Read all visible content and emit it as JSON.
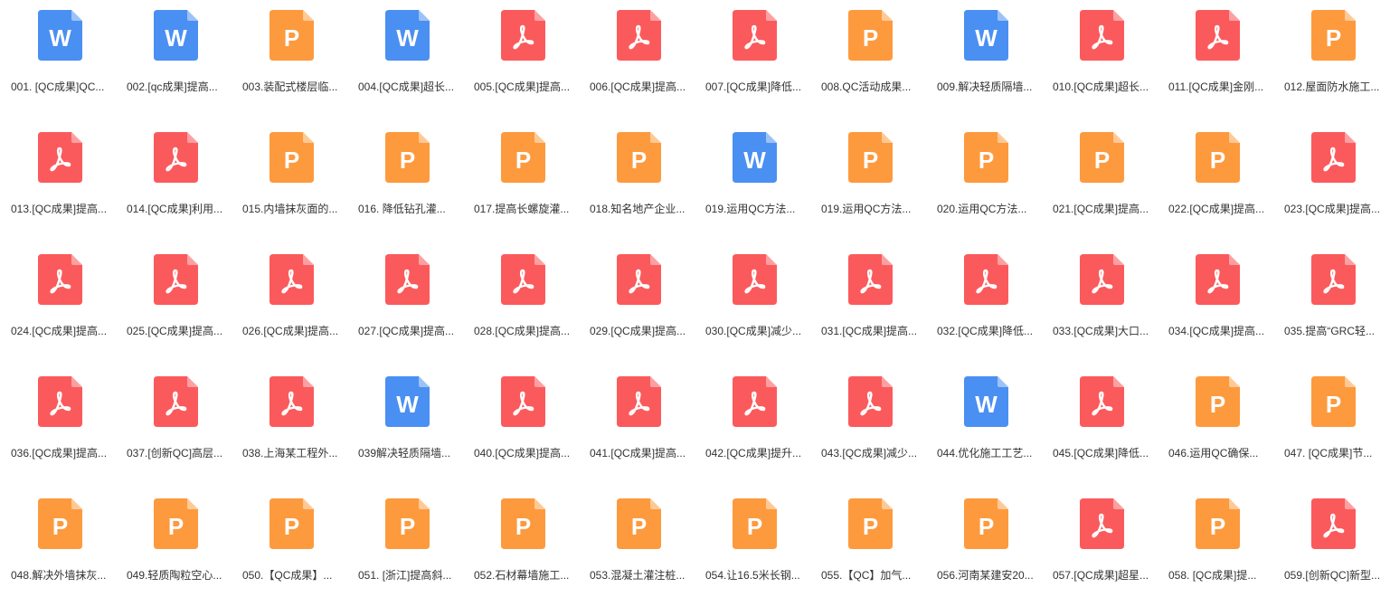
{
  "colors": {
    "word": "#4a8ff2",
    "word_fold": "#9cc2f8",
    "ppt": "#fd9a3e",
    "ppt_fold": "#ffc996",
    "pdf": "#fb5a5c",
    "pdf_fold": "#fda0a1",
    "label_text": "#333333"
  },
  "icons": {
    "word": {
      "icon_name": "word-document-icon",
      "glyph": "W"
    },
    "ppt": {
      "icon_name": "powerpoint-document-icon",
      "glyph": "P"
    },
    "pdf": {
      "icon_name": "pdf-document-icon",
      "glyph": ""
    }
  },
  "files": [
    {
      "type": "word",
      "label": "001. [QC成果]QC..."
    },
    {
      "type": "word",
      "label": "002.[qc成果]提高..."
    },
    {
      "type": "ppt",
      "label": "003.装配式楼层临..."
    },
    {
      "type": "word",
      "label": "004.[QC成果]超长..."
    },
    {
      "type": "pdf",
      "label": "005.[QC成果]提高..."
    },
    {
      "type": "pdf",
      "label": "006.[QC成果]提高..."
    },
    {
      "type": "pdf",
      "label": "007.[QC成果]降低..."
    },
    {
      "type": "ppt",
      "label": "008.QC活动成果..."
    },
    {
      "type": "word",
      "label": "009.解决轻质隔墙..."
    },
    {
      "type": "pdf",
      "label": "010.[QC成果]超长..."
    },
    {
      "type": "pdf",
      "label": "011.[QC成果]金刚..."
    },
    {
      "type": "ppt",
      "label": "012.屋面防水施工..."
    },
    {
      "type": "pdf",
      "label": "013.[QC成果]提高..."
    },
    {
      "type": "pdf",
      "label": "014.[QC成果]利用..."
    },
    {
      "type": "ppt",
      "label": "015.内墙抹灰面的..."
    },
    {
      "type": "ppt",
      "label": "016. 降低钻孔灌..."
    },
    {
      "type": "ppt",
      "label": "017.提高长螺旋灌..."
    },
    {
      "type": "ppt",
      "label": "018.知名地产企业..."
    },
    {
      "type": "word",
      "label": "019.运用QC方法..."
    },
    {
      "type": "ppt",
      "label": "019.运用QC方法..."
    },
    {
      "type": "ppt",
      "label": "020.运用QC方法..."
    },
    {
      "type": "ppt",
      "label": "021.[QC成果]提高..."
    },
    {
      "type": "ppt",
      "label": "022.[QC成果]提高..."
    },
    {
      "type": "pdf",
      "label": "023.[QC成果]提高..."
    },
    {
      "type": "pdf",
      "label": "024.[QC成果]提高..."
    },
    {
      "type": "pdf",
      "label": "025.[QC成果]提高..."
    },
    {
      "type": "pdf",
      "label": "026.[QC成果]提高..."
    },
    {
      "type": "pdf",
      "label": "027.[QC成果]提高..."
    },
    {
      "type": "pdf",
      "label": "028.[QC成果]提高..."
    },
    {
      "type": "pdf",
      "label": "029.[QC成果]提高..."
    },
    {
      "type": "pdf",
      "label": "030.[QC成果]减少..."
    },
    {
      "type": "pdf",
      "label": "031.[QC成果]提高..."
    },
    {
      "type": "pdf",
      "label": "032.[QC成果]降低..."
    },
    {
      "type": "pdf",
      "label": "033.[QC成果]大口..."
    },
    {
      "type": "pdf",
      "label": "034.[QC成果]提高..."
    },
    {
      "type": "pdf",
      "label": "035.提高“GRC轻..."
    },
    {
      "type": "pdf",
      "label": "036.[QC成果]提高..."
    },
    {
      "type": "pdf",
      "label": "037.[创新QC]高层..."
    },
    {
      "type": "pdf",
      "label": "038.上海某工程外..."
    },
    {
      "type": "word",
      "label": "039解决轻质隔墙..."
    },
    {
      "type": "pdf",
      "label": "040.[QC成果]提高..."
    },
    {
      "type": "pdf",
      "label": "041.[QC成果]提高..."
    },
    {
      "type": "pdf",
      "label": "042.[QC成果]提升..."
    },
    {
      "type": "pdf",
      "label": "043.[QC成果]减少..."
    },
    {
      "type": "word",
      "label": "044.优化施工工艺..."
    },
    {
      "type": "pdf",
      "label": "045.[QC成果]降低..."
    },
    {
      "type": "ppt",
      "label": "046.运用QC确保..."
    },
    {
      "type": "ppt",
      "label": "047. [QC成果]节..."
    },
    {
      "type": "ppt",
      "label": "048.解决外墙抹灰..."
    },
    {
      "type": "ppt",
      "label": "049.轻质陶粒空心..."
    },
    {
      "type": "ppt",
      "label": "050.【QC成果】..."
    },
    {
      "type": "ppt",
      "label": "051. [浙江]提高斜..."
    },
    {
      "type": "ppt",
      "label": "052.石材幕墙施工..."
    },
    {
      "type": "ppt",
      "label": "053.混凝土灌注桩..."
    },
    {
      "type": "ppt",
      "label": "054.让16.5米长钢..."
    },
    {
      "type": "ppt",
      "label": "055.【QC】加气..."
    },
    {
      "type": "ppt",
      "label": "056.河南某建安20..."
    },
    {
      "type": "pdf",
      "label": "057.[QC成果]超星..."
    },
    {
      "type": "ppt",
      "label": "058. [QC成果]提..."
    },
    {
      "type": "pdf",
      "label": "059.[创新QC]新型..."
    }
  ]
}
